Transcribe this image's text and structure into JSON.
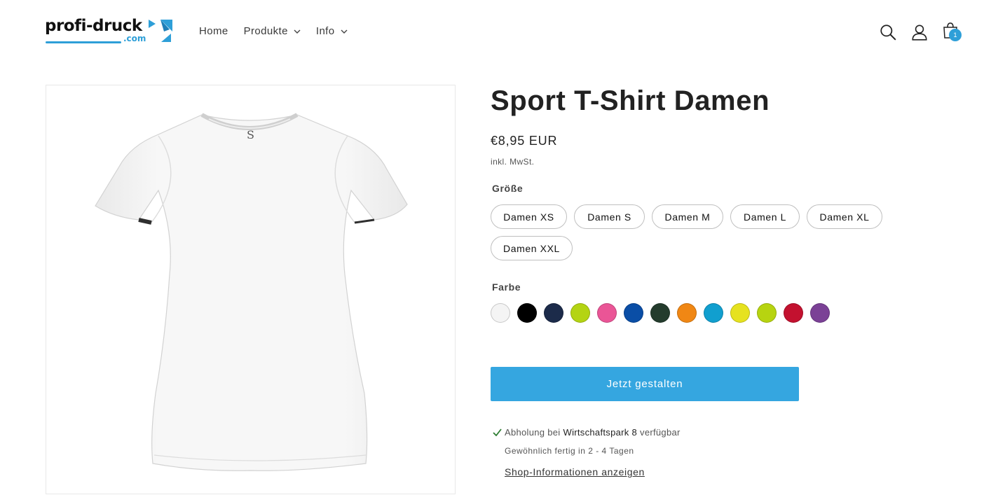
{
  "header": {
    "logo": {
      "main": "profi-druck",
      "sub": ".com"
    },
    "nav": [
      {
        "label": "Home",
        "has_dropdown": false
      },
      {
        "label": "Produkte",
        "has_dropdown": true
      },
      {
        "label": "Info",
        "has_dropdown": true
      }
    ],
    "icons": [
      "search-icon",
      "account-icon",
      "cart-icon"
    ],
    "cart_count": "1"
  },
  "product": {
    "title": "Sport T-Shirt Damen",
    "price": "€8,95 EUR",
    "tax_note": "inkl. MwSt.",
    "size": {
      "label": "Größe",
      "options": [
        "Damen XS",
        "Damen S",
        "Damen M",
        "Damen L",
        "Damen XL",
        "Damen XXL"
      ]
    },
    "color": {
      "label": "Farbe",
      "swatches": [
        "#f4f4f4",
        "#000000",
        "#1c2b4a",
        "#b4d413",
        "#ea5596",
        "#0a4ea6",
        "#243c2d",
        "#f08714",
        "#119fcf",
        "#e6e21f",
        "#b7d410",
        "#c3112f",
        "#7b4196"
      ]
    },
    "cta_label": "Jetzt gestalten",
    "pickup": {
      "prefix": "Abholung bei",
      "location": "Wirtschaftspark 8",
      "suffix": "verfügbar",
      "time": "Gewöhnlich fertig in 2 - 4 Tagen",
      "link": "Shop-Informationen anzeigen"
    }
  },
  "colors": {
    "accent": "#35a6e0",
    "check": "#2e7d32"
  }
}
